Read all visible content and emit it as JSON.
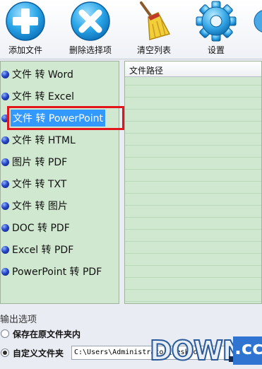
{
  "toolbar": {
    "add_files": "添加文件",
    "delete_selected": "删除选择项",
    "clear_list": "清空列表",
    "settings": "设置"
  },
  "conversions": [
    {
      "label": "文件 转 Word",
      "selected": false
    },
    {
      "label": "文件 转 Excel",
      "selected": false
    },
    {
      "label": "文件 转 PowerPoint",
      "selected": true
    },
    {
      "label": "文件 转 HTML",
      "selected": false
    },
    {
      "label": "图片 转 PDF",
      "selected": false
    },
    {
      "label": "文件 转 TXT",
      "selected": false
    },
    {
      "label": "文件 转 图片",
      "selected": false
    },
    {
      "label": "DOC 转 PDF",
      "selected": false
    },
    {
      "label": "Excel 转 PDF",
      "selected": false
    },
    {
      "label": "PowerPoint 转 PDF",
      "selected": false
    }
  ],
  "file_list": {
    "column_header": "文件路径"
  },
  "output": {
    "title": "输出选项",
    "options": [
      {
        "label": "保存在原文件夹内",
        "checked": false
      },
      {
        "label": "自定义文件夹",
        "checked": true
      }
    ],
    "custom_path": "C:\\Users\\Administrator\\Desktop"
  },
  "watermark": {
    "brand": "DOWN",
    "suffix": ".cc"
  },
  "colors": {
    "list_background": "#cfe8cf",
    "selection_highlight": "#3399ff",
    "annotation_box": "#e2141c"
  }
}
